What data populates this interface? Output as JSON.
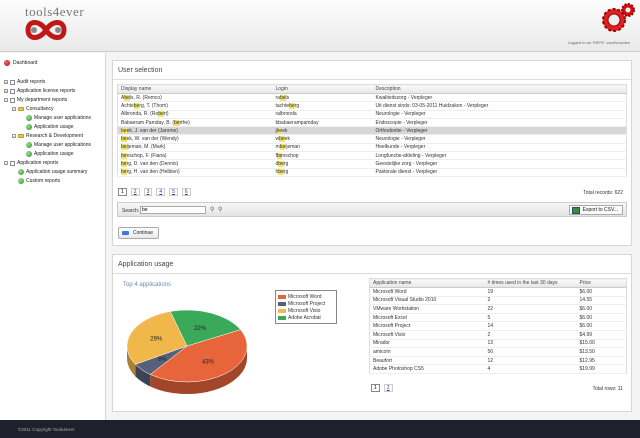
{
  "header": {
    "logo": "tools4ever",
    "logged_in": "Logged in as: RSP\\F. vandVoorden"
  },
  "sidebar": {
    "dashboard": "Dashboard",
    "items": [
      {
        "label": "Audit reports"
      },
      {
        "label": "Application license reports"
      },
      {
        "label": "My department reports"
      },
      {
        "label": "Consultancy"
      },
      {
        "label": "Manage user applications"
      },
      {
        "label": "Application usage"
      },
      {
        "label": "Research & Development"
      },
      {
        "label": "Manage user applications"
      },
      {
        "label": "Application usage"
      },
      {
        "label": "Application reports"
      },
      {
        "label": "Application usage summary"
      },
      {
        "label": "Custom reports"
      }
    ]
  },
  "user_selection": {
    "title": "User selection",
    "columns": [
      "Display name",
      "Login",
      "Description"
    ],
    "rows": [
      {
        "name_pre": "A",
        "name_hl": "be",
        "name_post": "ls, R. (Remco)",
        "login_pre": "ra",
        "login_hl": "be",
        "login_post": "ls",
        "desc": "Kwaliteitszorg - Verpleger"
      },
      {
        "name_pre": "Achte",
        "name_hl": "be",
        "name_post": "rg, T. (Thom)",
        "login_pre": "tachte",
        "login_hl": "be",
        "login_post": "rg",
        "desc": "Uit dienst sinds: 03-05-2011 Huidzaken - Verpleger"
      },
      {
        "name_pre": "Albronda, R. (Ro",
        "name_hl": "be",
        "name_post": "rt)",
        "login_pre": "ralbronda",
        "login_hl": "",
        "login_post": "",
        "desc": "Neurologie - Verpleger"
      },
      {
        "name_pre": "Babaeram Pamday, B. (",
        "name_hl": "be",
        "name_post": "rthe)",
        "login_pre": "bbabaerampamday",
        "login_hl": "",
        "login_post": "",
        "desc": "Endoscopie - Verpleger"
      },
      {
        "name_pre": "",
        "name_hl": "be",
        "name_post": "ek, J. van der (Jarome)",
        "login_pre": "j",
        "login_hl": "be",
        "login_post": "ek",
        "desc": "Orthodontie - Verpleger"
      },
      {
        "name_pre": "",
        "name_hl": "be",
        "name_post": "ek, W. van der (Wendy)",
        "login_pre": "w",
        "login_hl": "be",
        "login_post": "ek",
        "desc": "Neurologie - Verpleger"
      },
      {
        "name_pre": "",
        "name_hl": "be",
        "name_post": "ijeman, M. (Mark)",
        "login_pre": "m",
        "login_hl": "be",
        "login_post": "ijeman",
        "desc": "Heelkunde - Verpleger"
      },
      {
        "name_pre": "",
        "name_hl": "be",
        "name_post": "nschop, F. (Fiana)",
        "login_pre": "f",
        "login_hl": "be",
        "login_post": "nschop",
        "desc": "Longfunctie-afdeling - Verpleger"
      },
      {
        "name_pre": "",
        "name_hl": "be",
        "name_post": "rg, D. van den (Dennis)",
        "login_pre": "d",
        "login_hl": "be",
        "login_post": "rg",
        "desc": "Geestelijke zorg - Verpleger"
      },
      {
        "name_pre": "",
        "name_hl": "be",
        "name_post": "rg, H. van den (Helbien)",
        "login_pre": "h",
        "login_hl": "be",
        "login_post": "rg",
        "desc": "Pastorale dienst - Verpleger"
      }
    ],
    "pages": [
      "1",
      "2",
      "3",
      "4",
      "5",
      "6"
    ],
    "total": "Total records: 622",
    "search_label": "Search:",
    "search_value": "be",
    "export_label": "Export to CSV...",
    "continue_label": "Continue"
  },
  "app_usage": {
    "title": "Application usage",
    "chart_data": {
      "type": "pie",
      "title": "Top 4 applications",
      "series": [
        {
          "name": "Microsoft Word",
          "value": 43,
          "label": "43%",
          "color": "#e8643a"
        },
        {
          "name": "Microsoft Project",
          "value": 6,
          "label": "6%",
          "color": "#55607a"
        },
        {
          "name": "Microsoft Visio",
          "value": 29,
          "label": "29%",
          "color": "#f0b84a"
        },
        {
          "name": "Adobe Acrobat",
          "value": 22,
          "label": "22%",
          "color": "#3aaa5a"
        }
      ],
      "legend": "right"
    },
    "columns": [
      "Application name",
      "# times used in the last 30 days",
      "Price"
    ],
    "rows": [
      [
        "Microsoft Word",
        "19",
        "$6.00"
      ],
      [
        "Microsoft Visual Studio 2010",
        "2",
        "14.55"
      ],
      [
        "VMware Workstation",
        "22",
        "$6.00"
      ],
      [
        "Microsoft Excel",
        "5",
        "$6.00"
      ],
      [
        "Microsoft Project",
        "14",
        "$6.00"
      ],
      [
        "Microsoft Visio",
        "2",
        "$4.99"
      ],
      [
        "Mirador",
        "13",
        "$15.00"
      ],
      [
        "amicom",
        "56",
        "$13.50"
      ],
      [
        "Beaufort",
        "12",
        "$12.95"
      ],
      [
        "Adobe Photoshop CS5",
        "4",
        "$19.99"
      ]
    ],
    "pages": [
      "1",
      "2"
    ],
    "total": "Total rows: 11"
  },
  "footer": {
    "copyright": "©2011 Copyright Tools4ever"
  }
}
